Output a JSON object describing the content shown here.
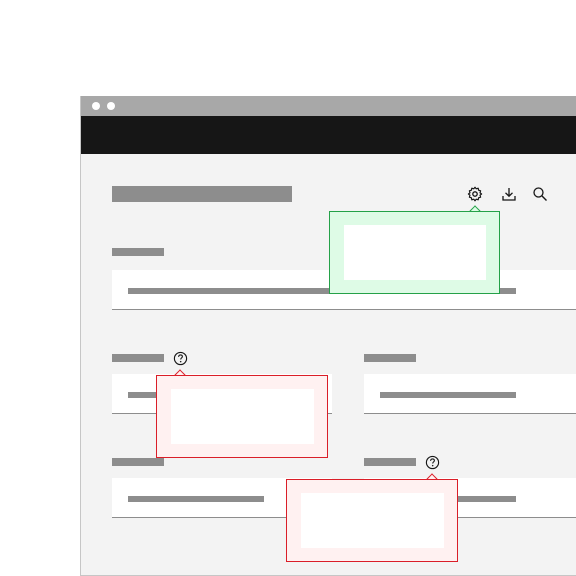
{
  "window": {
    "title": "",
    "colors": {
      "titlebar": "#a8a8a8",
      "appbar": "#161616",
      "background": "#f3f3f3",
      "success_tooltip": "#24a148",
      "error_tooltip": "#da1e28"
    }
  },
  "toolbar": {
    "icons": [
      "gear-icon",
      "download-icon",
      "search-icon"
    ]
  },
  "form": {
    "title_placeholder": "",
    "fields": [
      {
        "label": "",
        "value": ""
      },
      {
        "label": "",
        "value": "",
        "has_help": true
      },
      {
        "label": "",
        "value": ""
      },
      {
        "label": "",
        "value": ""
      },
      {
        "label": "",
        "value": "",
        "has_help": true
      }
    ]
  },
  "tooltips": {
    "settings": {
      "text": "",
      "tone": "success"
    },
    "help_left": {
      "text": "",
      "tone": "error"
    },
    "help_right": {
      "text": "",
      "tone": "error"
    }
  }
}
